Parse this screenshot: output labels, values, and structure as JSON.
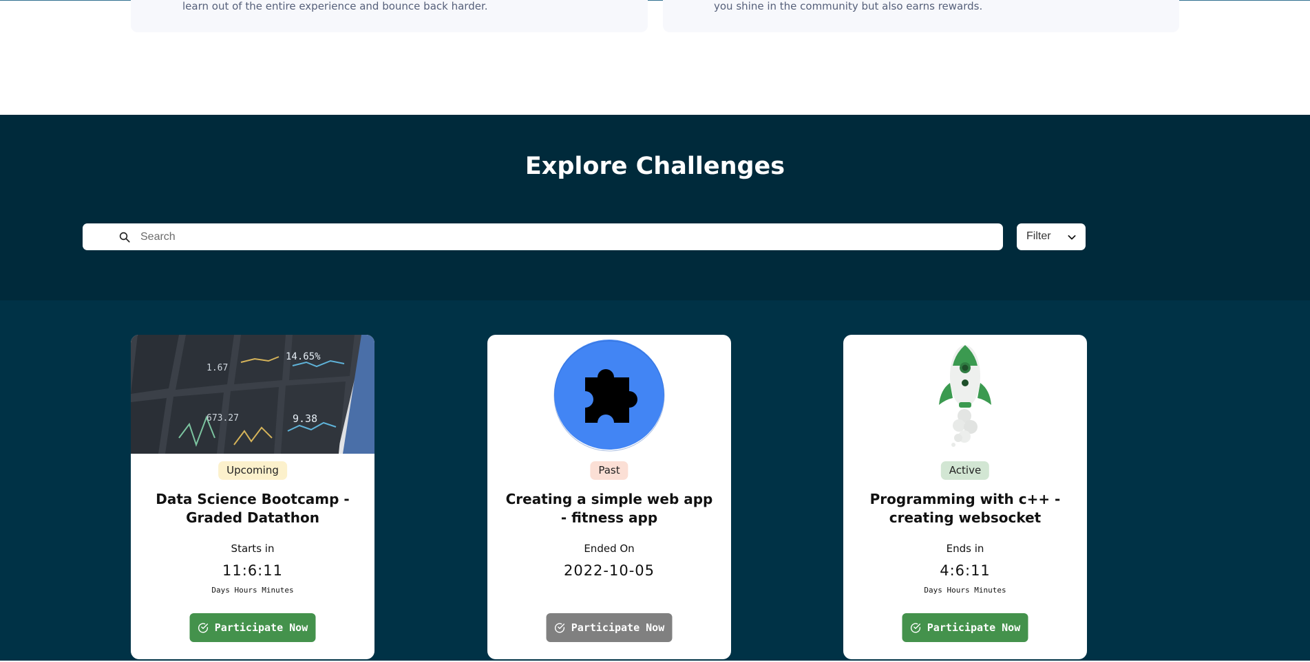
{
  "features": [
    {
      "text": "learn out of the entire experience and bounce back harder."
    },
    {
      "text": "you shine in the community but also earns rewards."
    }
  ],
  "explore": {
    "title": "Explore Challenges",
    "search_placeholder": "Search",
    "filter_label": "Filter"
  },
  "colors": {
    "hero_bg": "#002a3b",
    "cards_bg": "#003246",
    "cta_active": "#44924c",
    "cta_disabled": "#808080",
    "badge_upcoming": "#fcf1cc",
    "badge_past": "#fbdfd5",
    "badge_active": "#d2e6d3"
  },
  "cards": [
    {
      "status": "Upcoming",
      "title": "Data Science Bootcamp - Graded Datathon",
      "time_label": "Starts in",
      "time_value": "11:6:11",
      "time_units": "Days Hours Minutes",
      "cta": "Participate Now",
      "media_icon": "dashboard-photo"
    },
    {
      "status": "Past",
      "title": "Creating a simple web app - fitness app",
      "time_label": "Ended On",
      "time_value": "2022-10-05",
      "time_units": "",
      "cta": "Participate Now",
      "media_icon": "puzzle-icon"
    },
    {
      "status": "Active",
      "title": "Programming with c++ - creating websocket",
      "time_label": "Ends in",
      "time_value": "4:6:11",
      "time_units": "Days Hours Minutes",
      "cta": "Participate Now",
      "media_icon": "rocket-icon"
    }
  ]
}
